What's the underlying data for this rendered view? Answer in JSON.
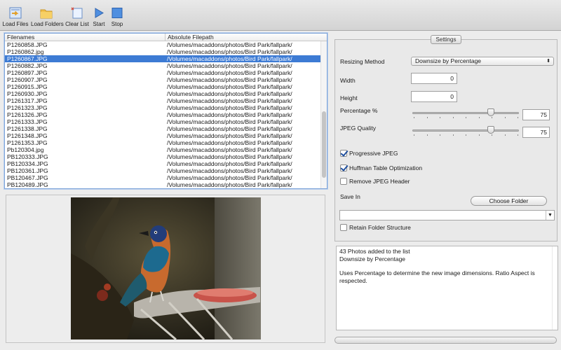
{
  "toolbar": {
    "buttons": [
      {
        "label": "Load Files",
        "icon": "load-files-icon"
      },
      {
        "label": "Load Folders",
        "icon": "folder-icon"
      },
      {
        "label": "Clear List",
        "icon": "clear-list-icon"
      },
      {
        "label": "Start",
        "icon": "play-icon"
      },
      {
        "label": "Stop",
        "icon": "stop-icon"
      }
    ]
  },
  "file_table": {
    "headers": [
      "Filenames",
      "Absolute Filepath"
    ],
    "selected_index": 2,
    "rows": [
      {
        "name": "P1260858.JPG",
        "path": "/Volumes/macaddons/photos/Bird Park/fallpark/"
      },
      {
        "name": "P1260862.jpg",
        "path": "/Volumes/macaddons/photos/Bird Park/fallpark/"
      },
      {
        "name": "P1260867.JPG",
        "path": "/Volumes/macaddons/photos/Bird Park/fallpark/"
      },
      {
        "name": "P1260882.JPG",
        "path": "/Volumes/macaddons/photos/Bird Park/fallpark/"
      },
      {
        "name": "P1260897.JPG",
        "path": "/Volumes/macaddons/photos/Bird Park/fallpark/"
      },
      {
        "name": "P1260907.JPG",
        "path": "/Volumes/macaddons/photos/Bird Park/fallpark/"
      },
      {
        "name": "P1260915.JPG",
        "path": "/Volumes/macaddons/photos/Bird Park/fallpark/"
      },
      {
        "name": "P1260930.JPG",
        "path": "/Volumes/macaddons/photos/Bird Park/fallpark/"
      },
      {
        "name": "P1261317.JPG",
        "path": "/Volumes/macaddons/photos/Bird Park/fallpark/"
      },
      {
        "name": "P1261323.JPG",
        "path": "/Volumes/macaddons/photos/Bird Park/fallpark/"
      },
      {
        "name": "P1261326.JPG",
        "path": "/Volumes/macaddons/photos/Bird Park/fallpark/"
      },
      {
        "name": "P1261333.JPG",
        "path": "/Volumes/macaddons/photos/Bird Park/fallpark/"
      },
      {
        "name": "P1261338.JPG",
        "path": "/Volumes/macaddons/photos/Bird Park/fallpark/"
      },
      {
        "name": "P1261348.JPG",
        "path": "/Volumes/macaddons/photos/Bird Park/fallpark/"
      },
      {
        "name": "P1261353.JPG",
        "path": "/Volumes/macaddons/photos/Bird Park/fallpark/"
      },
      {
        "name": "Pb120304.jpg",
        "path": "/Volumes/macaddons/photos/Bird Park/fallpark/"
      },
      {
        "name": "PB120333.JPG",
        "path": "/Volumes/macaddons/photos/Bird Park/fallpark/"
      },
      {
        "name": "PB120334.JPG",
        "path": "/Volumes/macaddons/photos/Bird Park/fallpark/"
      },
      {
        "name": "PB120361.JPG",
        "path": "/Volumes/macaddons/photos/Bird Park/fallpark/"
      },
      {
        "name": "PB120467.JPG",
        "path": "/Volumes/macaddons/photos/Bird Park/fallpark/"
      },
      {
        "name": "PB120489.JPG",
        "path": "/Volumes/macaddons/photos/Bird Park/fallpark/"
      }
    ]
  },
  "settings": {
    "tab_label": "Settings",
    "resizing_method": {
      "label": "Resizing Method",
      "value": "Downsize by Percentage"
    },
    "width": {
      "label": "Width",
      "value": "0"
    },
    "height": {
      "label": "Height",
      "value": "0"
    },
    "percentage": {
      "label": "Percentage %",
      "value": "75",
      "fraction": 0.75
    },
    "jpeg_quality": {
      "label": "JPEG Quality",
      "value": "75",
      "fraction": 0.75
    },
    "progressive_jpeg": {
      "label": "Progressive JPEG",
      "checked": true
    },
    "huffman": {
      "label": "Huffman Table Optimization",
      "checked": true
    },
    "remove_header": {
      "label": "Remove JPEG Header",
      "checked": false
    },
    "save_in": {
      "label": "Save In",
      "button": "Choose Folder",
      "value": ""
    },
    "retain_structure": {
      "label": "Retain Folder Structure",
      "checked": false
    }
  },
  "log": {
    "line1": "43 Photos added to the list",
    "line2": "Downsize by Percentage",
    "line3": "Uses Percentage to determine the new image dimensions. Ratio Aspect is respected."
  },
  "progress": {
    "fraction": 0
  },
  "colors": {
    "selection": "#3d7bd4",
    "accent": "#1f4f9e"
  }
}
